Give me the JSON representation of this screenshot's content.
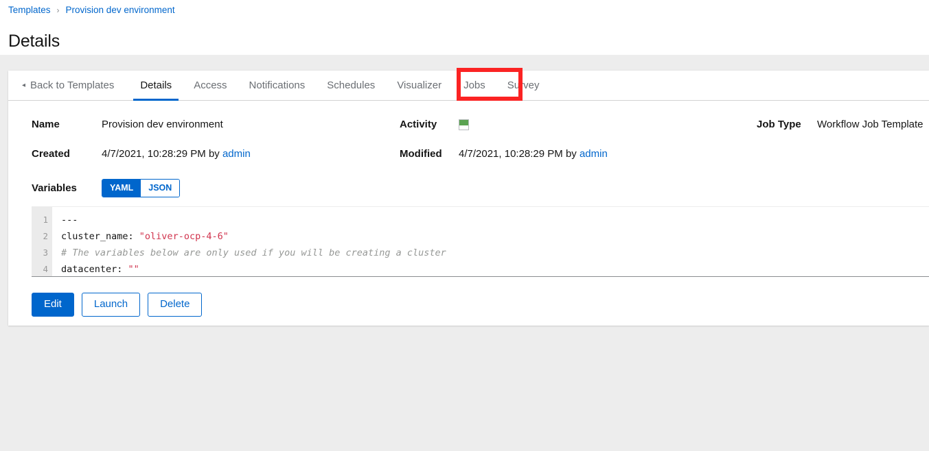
{
  "breadcrumb": {
    "root_label": "Templates",
    "separator": "›",
    "current_label": "Provision dev environment"
  },
  "page_title": "Details",
  "tabs": {
    "back_caret": "◂",
    "back_label": "Back to Templates",
    "items": [
      {
        "label": "Details",
        "state": "active"
      },
      {
        "label": "Access",
        "state": "normal"
      },
      {
        "label": "Notifications",
        "state": "normal"
      },
      {
        "label": "Schedules",
        "state": "normal"
      },
      {
        "label": "Visualizer",
        "state": "normal"
      },
      {
        "label": "Jobs",
        "state": "hovered"
      },
      {
        "label": "Survey",
        "state": "normal"
      }
    ]
  },
  "annotation": {
    "highlight_color": "#fb2323",
    "target_tab": "Jobs"
  },
  "details": {
    "name_label": "Name",
    "name_value": "Provision dev environment",
    "activity_label": "Activity",
    "activity_icon": "activity-sparkline",
    "activity_bar_color": "#5ba352",
    "job_type_label": "Job Type",
    "job_type_value": "Workflow Job Template",
    "created_label": "Created",
    "created_value": "4/7/2021, 10:28:29 PM by ",
    "created_user": "admin",
    "modified_label": "Modified",
    "modified_value": "4/7/2021, 10:28:29 PM by ",
    "modified_user": "admin"
  },
  "variables": {
    "label": "Variables",
    "format_yaml": "YAML",
    "format_json": "JSON",
    "selected_format": "YAML",
    "line_numbers": [
      "1",
      "2",
      "3",
      "4"
    ],
    "lines": [
      {
        "plain": "---",
        "string": "",
        "comment": ""
      },
      {
        "plain": "cluster_name: ",
        "string": "\"oliver-ocp-4-6\"",
        "comment": ""
      },
      {
        "plain": "",
        "string": "",
        "comment": "# The variables below are only used if you will be creating a cluster"
      },
      {
        "plain": "datacenter: ",
        "string": "\"\"",
        "comment": ""
      }
    ]
  },
  "actions": {
    "edit_label": "Edit",
    "launch_label": "Launch",
    "delete_label": "Delete"
  },
  "colors": {
    "accent": "#0066cc",
    "highlight": "#fb2323",
    "string_token": "#d1344e",
    "comment_token": "#969896",
    "page_bg": "#ededed"
  }
}
